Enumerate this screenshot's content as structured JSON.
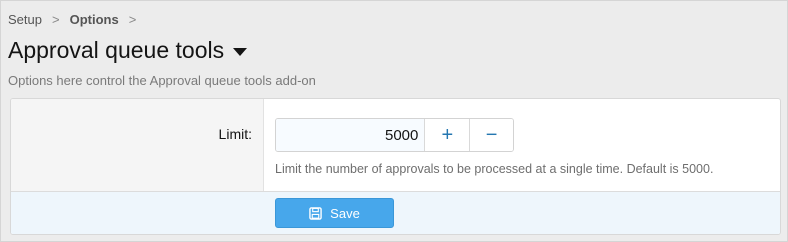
{
  "breadcrumb": {
    "items": [
      "Setup",
      "Options"
    ],
    "separator": ">"
  },
  "page": {
    "title": "Approval queue tools",
    "description": "Options here control the Approval queue tools add-on"
  },
  "option": {
    "label": "Limit:",
    "value": "5000",
    "increment": "+",
    "decrement": "−",
    "hint": "Limit the number of approvals to be processed at a single time. Default is 5000."
  },
  "actions": {
    "save_label": "Save"
  },
  "colors": {
    "accent": "#2577b1",
    "save_button": "#47a7eb",
    "footer_bg": "#eef6fc"
  },
  "icons": {
    "caret": "caret-down-icon",
    "save": "floppy-disk-icon"
  }
}
